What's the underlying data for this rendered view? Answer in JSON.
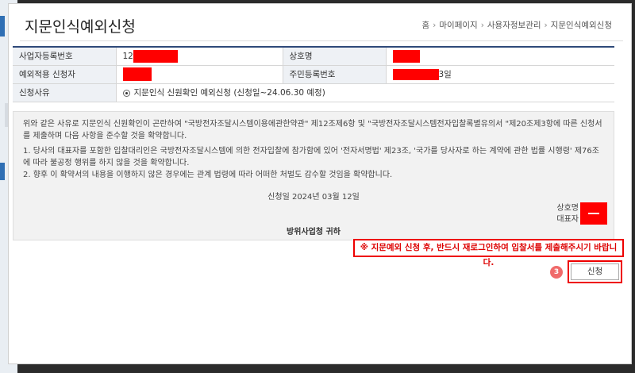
{
  "page_title": "지문인식예외신청",
  "breadcrumb": [
    "홈",
    "마이페이지",
    "사용자정보관리",
    "지문인식예외신청"
  ],
  "info_table": {
    "biz_reg_no_label": "사업자등록번호",
    "biz_reg_no_value": "12",
    "company_name_label": "상호명",
    "applicant_label": "예외적용 신청자",
    "resident_no_label": "주민등록번호",
    "resident_no_suffix": "3일",
    "reason_label": "신청사유",
    "reason_value": "지문인식 신원확인 예외신청 (신청일~24.06.30 예정)"
  },
  "pledge": {
    "intro": "위와 같은 사유로 지문인식 신원확인이 곤란하여 \"국방전자조달시스템이용에관한약관\" 제12조제6항 및 \"국방전자조달시스템전자입찰록별유의서 \"제20조제3항에 따른 신청서를 제출하며 다음 사항을 준수할 것을 확약합니다.",
    "item1": "1. 당사의 대표자를 포함한 입찰대리인은 국방전자조달시스템에 의한 전자입찰에 참가함에 있어 '전자서명법' 제23조, '국가를 당사자로 하는 계약에 관한 법률 시행령' 제76조에 따라 불공정 행위를 하지 않을 것을 확약합니다.",
    "item2": "2. 향후 이 확약서의 내용을 이행하지 않은 경우에는 관계 법령에 따라 어떠한 처벌도 감수할 것임을 확약합니다.",
    "date": "신청일 2024년 03월 12일",
    "company_label": "상호명",
    "rep_label": "대표자",
    "addressee": "방위사업청 귀하"
  },
  "notice": "※ 지문예외 신청 후, 반드시 재로그인하여 입찰서를 제출해주시기 바랍니다.",
  "step_number": "3",
  "submit_label": "신청",
  "collapse_icon": "‹"
}
